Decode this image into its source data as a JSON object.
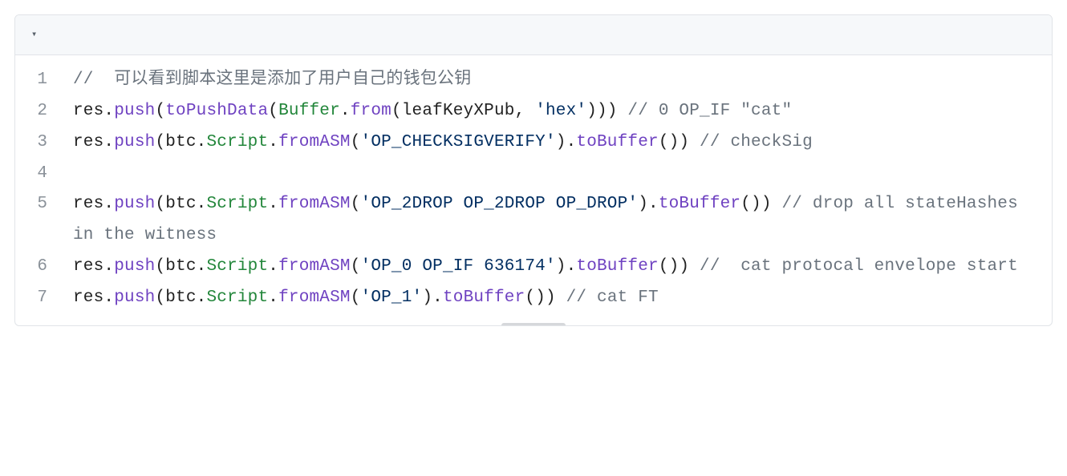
{
  "toolbar": {
    "dropdown_glyph": "▾"
  },
  "lines": [
    {
      "n": "1",
      "tokens": [
        {
          "c": "tk-comment",
          "t": "//  可以看到脚本这里是添加了用户自己的钱包公钥"
        }
      ]
    },
    {
      "n": "2",
      "tokens": [
        {
          "c": "tk-plain",
          "t": "res"
        },
        {
          "c": "tk-punct",
          "t": "."
        },
        {
          "c": "tk-method",
          "t": "push"
        },
        {
          "c": "tk-punct",
          "t": "("
        },
        {
          "c": "tk-func",
          "t": "toPushData"
        },
        {
          "c": "tk-punct",
          "t": "("
        },
        {
          "c": "tk-class",
          "t": "Buffer"
        },
        {
          "c": "tk-punct",
          "t": "."
        },
        {
          "c": "tk-method",
          "t": "from"
        },
        {
          "c": "tk-punct",
          "t": "("
        },
        {
          "c": "tk-plain",
          "t": "leafKeyXPub"
        },
        {
          "c": "tk-punct",
          "t": ", "
        },
        {
          "c": "tk-str",
          "t": "'hex'"
        },
        {
          "c": "tk-punct",
          "t": ")))"
        },
        {
          "c": "tk-plain",
          "t": " "
        },
        {
          "c": "tk-comment",
          "t": "// 0 OP_IF \"cat\""
        }
      ]
    },
    {
      "n": "3",
      "tokens": [
        {
          "c": "tk-plain",
          "t": "res"
        },
        {
          "c": "tk-punct",
          "t": "."
        },
        {
          "c": "tk-method",
          "t": "push"
        },
        {
          "c": "tk-punct",
          "t": "("
        },
        {
          "c": "tk-plain",
          "t": "btc"
        },
        {
          "c": "tk-punct",
          "t": "."
        },
        {
          "c": "tk-class",
          "t": "Script"
        },
        {
          "c": "tk-punct",
          "t": "."
        },
        {
          "c": "tk-method",
          "t": "fromASM"
        },
        {
          "c": "tk-punct",
          "t": "("
        },
        {
          "c": "tk-str",
          "t": "'OP_CHECKSIGVERIFY'"
        },
        {
          "c": "tk-punct",
          "t": ")"
        },
        {
          "c": "tk-punct",
          "t": "."
        },
        {
          "c": "tk-method",
          "t": "toBuffer"
        },
        {
          "c": "tk-punct",
          "t": "())"
        },
        {
          "c": "tk-plain",
          "t": " "
        },
        {
          "c": "tk-comment",
          "t": "// checkSig"
        }
      ]
    },
    {
      "n": "4",
      "tokens": [
        {
          "c": "tk-plain",
          "t": ""
        }
      ]
    },
    {
      "n": "5",
      "tokens": [
        {
          "c": "tk-plain",
          "t": "res"
        },
        {
          "c": "tk-punct",
          "t": "."
        },
        {
          "c": "tk-method",
          "t": "push"
        },
        {
          "c": "tk-punct",
          "t": "("
        },
        {
          "c": "tk-plain",
          "t": "btc"
        },
        {
          "c": "tk-punct",
          "t": "."
        },
        {
          "c": "tk-class",
          "t": "Script"
        },
        {
          "c": "tk-punct",
          "t": "."
        },
        {
          "c": "tk-method",
          "t": "fromASM"
        },
        {
          "c": "tk-punct",
          "t": "("
        },
        {
          "c": "tk-str",
          "t": "'OP_2DROP OP_2DROP OP_DROP'"
        },
        {
          "c": "tk-punct",
          "t": ")"
        },
        {
          "c": "tk-punct",
          "t": "."
        },
        {
          "c": "tk-method",
          "t": "toBuffer"
        },
        {
          "c": "tk-punct",
          "t": "())"
        },
        {
          "c": "tk-plain",
          "t": " "
        },
        {
          "c": "tk-comment",
          "t": "// drop all stateHashes in the witness"
        }
      ]
    },
    {
      "n": "6",
      "tokens": [
        {
          "c": "tk-plain",
          "t": "res"
        },
        {
          "c": "tk-punct",
          "t": "."
        },
        {
          "c": "tk-method",
          "t": "push"
        },
        {
          "c": "tk-punct",
          "t": "("
        },
        {
          "c": "tk-plain",
          "t": "btc"
        },
        {
          "c": "tk-punct",
          "t": "."
        },
        {
          "c": "tk-class",
          "t": "Script"
        },
        {
          "c": "tk-punct",
          "t": "."
        },
        {
          "c": "tk-method",
          "t": "fromASM"
        },
        {
          "c": "tk-punct",
          "t": "("
        },
        {
          "c": "tk-str",
          "t": "'OP_0 OP_IF 636174'"
        },
        {
          "c": "tk-punct",
          "t": ")"
        },
        {
          "c": "tk-punct",
          "t": "."
        },
        {
          "c": "tk-method",
          "t": "toBuffer"
        },
        {
          "c": "tk-punct",
          "t": "())"
        },
        {
          "c": "tk-plain",
          "t": " "
        },
        {
          "c": "tk-comment",
          "t": "//  cat protocal envelope start"
        }
      ]
    },
    {
      "n": "7",
      "tokens": [
        {
          "c": "tk-plain",
          "t": "res"
        },
        {
          "c": "tk-punct",
          "t": "."
        },
        {
          "c": "tk-method",
          "t": "push"
        },
        {
          "c": "tk-punct",
          "t": "("
        },
        {
          "c": "tk-plain",
          "t": "btc"
        },
        {
          "c": "tk-punct",
          "t": "."
        },
        {
          "c": "tk-class",
          "t": "Script"
        },
        {
          "c": "tk-punct",
          "t": "."
        },
        {
          "c": "tk-method",
          "t": "fromASM"
        },
        {
          "c": "tk-punct",
          "t": "("
        },
        {
          "c": "tk-str",
          "t": "'OP_1'"
        },
        {
          "c": "tk-punct",
          "t": ")"
        },
        {
          "c": "tk-punct",
          "t": "."
        },
        {
          "c": "tk-method",
          "t": "toBuffer"
        },
        {
          "c": "tk-punct",
          "t": "())"
        },
        {
          "c": "tk-plain",
          "t": " "
        },
        {
          "c": "tk-comment",
          "t": "// cat FT"
        }
      ]
    }
  ]
}
